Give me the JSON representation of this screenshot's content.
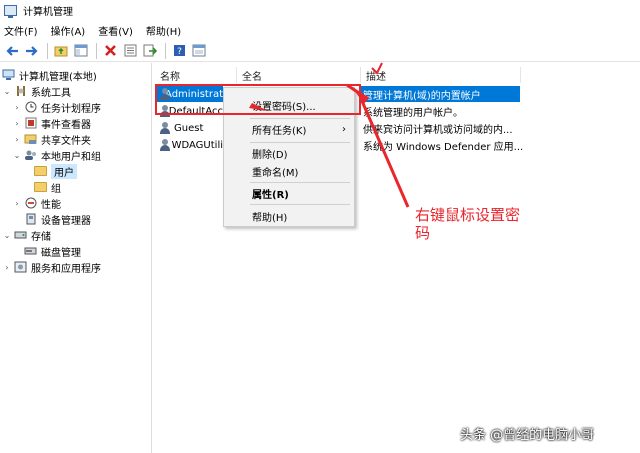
{
  "window": {
    "title": "计算机管理"
  },
  "menubar": [
    {
      "label": "文件(F)"
    },
    {
      "label": "操作(A)"
    },
    {
      "label": "查看(V)"
    },
    {
      "label": "帮助(H)"
    }
  ],
  "toolbar": {
    "icons": [
      "back-icon",
      "forward-icon",
      "up-folder-icon",
      "show-tree-icon",
      "delete-icon",
      "properties-icon",
      "export-icon",
      "help-icon",
      "console-icon"
    ]
  },
  "tree": [
    {
      "label": "计算机管理(本地)",
      "icon": "computer-icon",
      "expander": ""
    },
    {
      "label": "系统工具",
      "icon": "tools-icon",
      "expander": "⌄"
    },
    {
      "label": "任务计划程序",
      "icon": "clock-icon",
      "expander": "›"
    },
    {
      "label": "事件查看器",
      "icon": "event-viewer-icon",
      "expander": "›"
    },
    {
      "label": "共享文件夹",
      "icon": "shared-folder-icon",
      "expander": "›"
    },
    {
      "label": "本地用户和组",
      "icon": "users-group-icon",
      "expander": "⌄"
    },
    {
      "label": "用户",
      "icon": "folder-icon",
      "expander": ""
    },
    {
      "label": "组",
      "icon": "folder-icon",
      "expander": ""
    },
    {
      "label": "性能",
      "icon": "performance-icon",
      "expander": "›"
    },
    {
      "label": "设备管理器",
      "icon": "device-manager-icon",
      "expander": ""
    },
    {
      "label": "存储",
      "icon": "storage-icon",
      "expander": "⌄"
    },
    {
      "label": "磁盘管理",
      "icon": "disk-icon",
      "expander": ""
    },
    {
      "label": "服务和应用程序",
      "icon": "services-icon",
      "expander": "›"
    }
  ],
  "columns": {
    "name": "名称",
    "fullname": "全名",
    "description": "描述"
  },
  "users": [
    {
      "name": "Administrat",
      "fullname": "",
      "description": "管理计算机(域)的内置帐户"
    },
    {
      "name": "DefaultAcc",
      "fullname": "",
      "description": "系统管理的用户帐户。"
    },
    {
      "name": "Guest",
      "fullname": "",
      "description": "供来宾访问计算机或访问域的内..."
    },
    {
      "name": "WDAGUtili",
      "fullname": "",
      "description": "系统为 Windows Defender 应用..."
    }
  ],
  "context_menu": {
    "set_password": "设置密码(S)...",
    "all_tasks": "所有任务(K)",
    "submenu_arrow": "›",
    "delete": "删除(D)",
    "rename": "重命名(M)",
    "properties": "属性(R)",
    "help": "帮助(H)"
  },
  "annotation": {
    "text": "右键鼠标设置密码",
    "color": "#e8262c"
  },
  "watermark": "头条 @曾经的电脑小哥",
  "colors": {
    "selection": "#0078d7",
    "annotation": "#e8262c",
    "tree_selection": "#cce8ff"
  }
}
